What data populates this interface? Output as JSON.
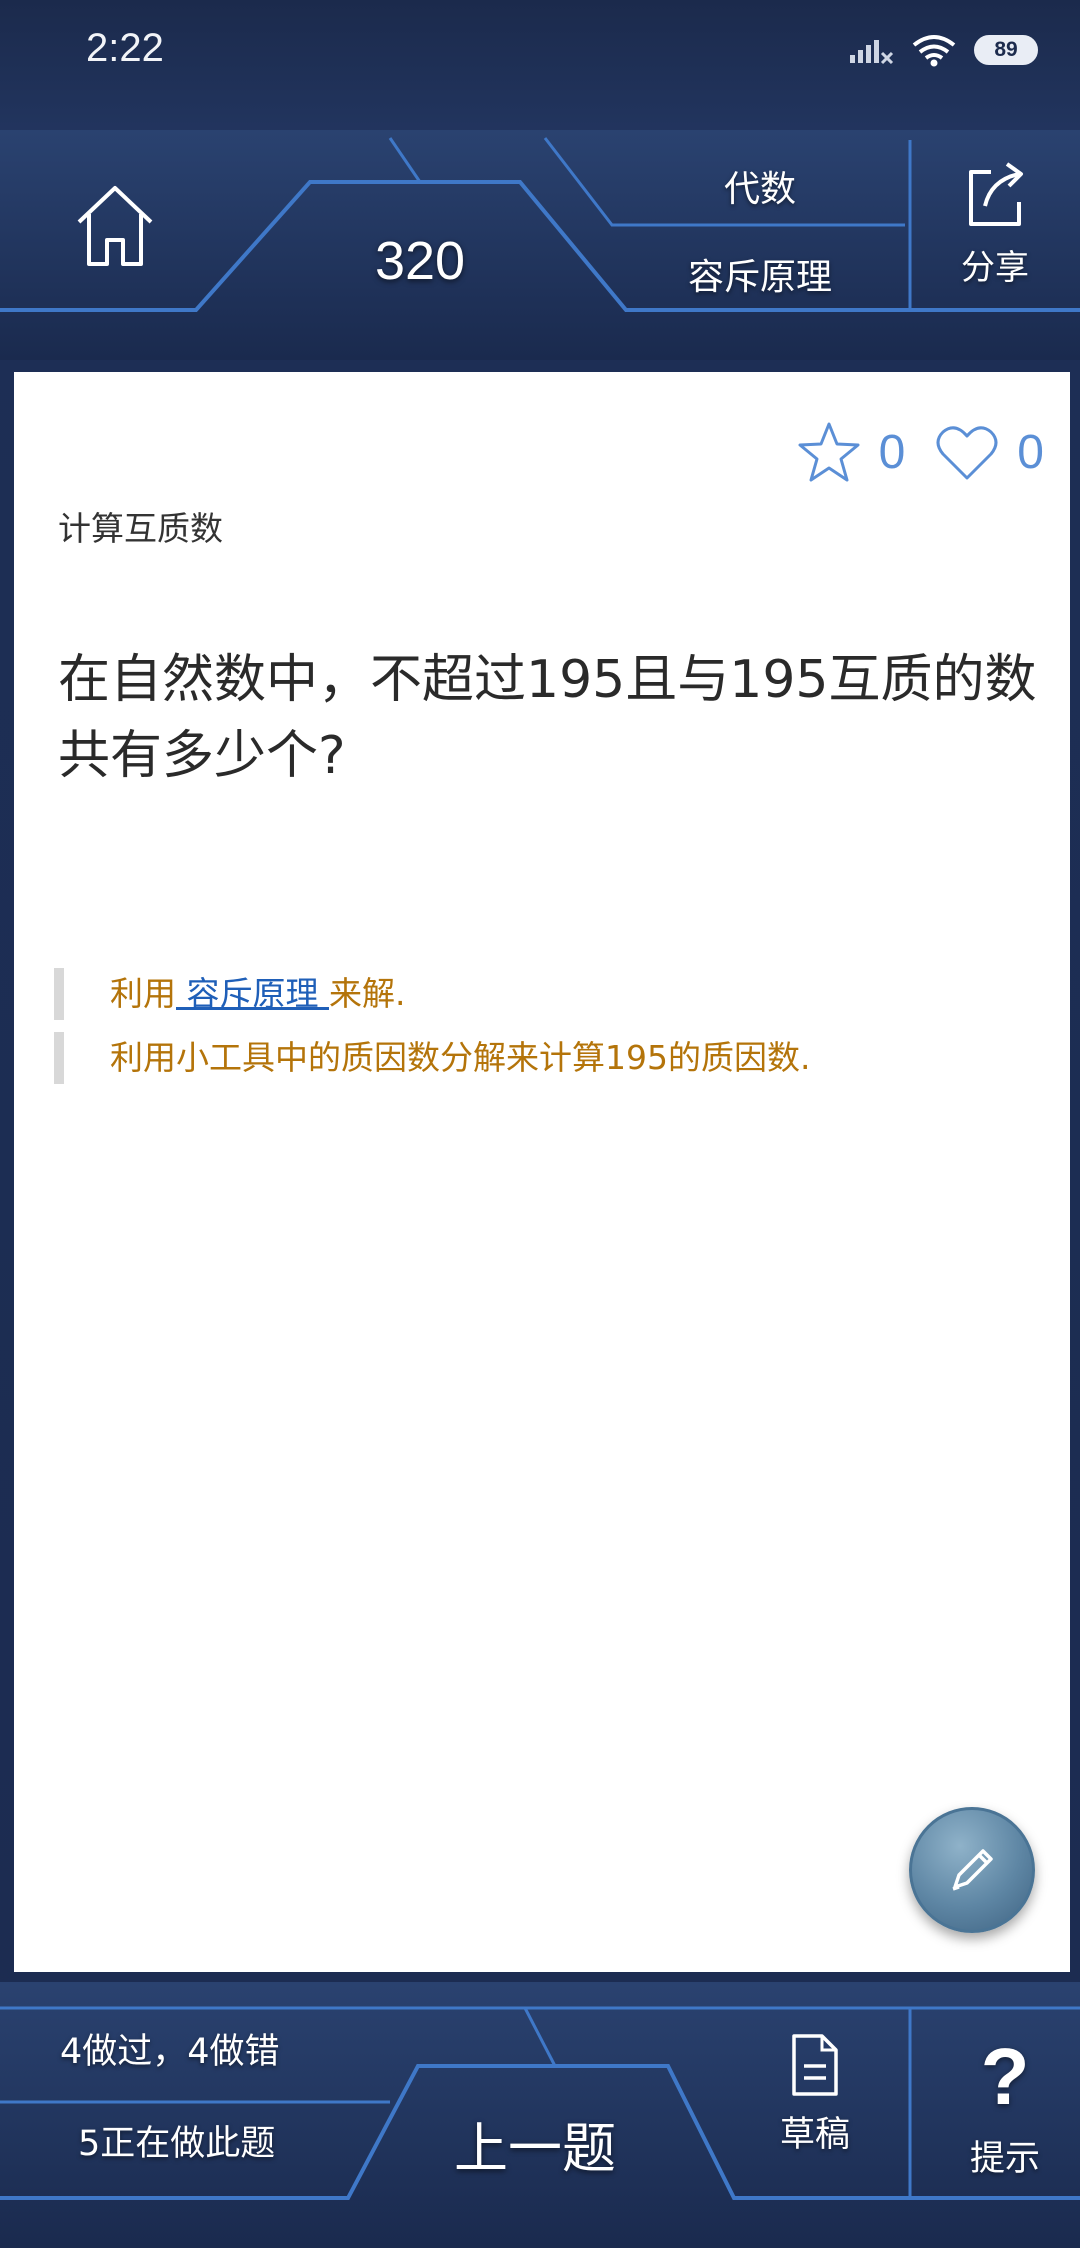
{
  "status_bar": {
    "time": "2:22",
    "battery": "89"
  },
  "header": {
    "home_icon": "home-icon",
    "problem_number": "320",
    "category": "代数",
    "topic": "容斥原理",
    "share_label": "分享",
    "share_icon": "share-icon"
  },
  "card": {
    "favorites_count": "0",
    "likes_count": "0",
    "subtitle": "计算互质数",
    "question": "在自然数中，不超过195且与195互质的数共有多少个?",
    "hints": [
      {
        "prefix": "利用",
        "link": " 容斥原理 ",
        "suffix": "来解."
      },
      {
        "text": "利用小工具中的质因数分解来计算195的质因数."
      }
    ],
    "edit_icon": "pencil-icon"
  },
  "bottom_bar": {
    "stat_done": "4做过，4做错",
    "stat_active": "5正在做此题",
    "prev_label": "上一题",
    "draft_label": "草稿",
    "hint_label": "提示",
    "hint_symbol": "?"
  },
  "colors": {
    "frame_dark": "#1c2b4d",
    "frame_glow": "#4d8ee0",
    "hint_text": "#b4740a",
    "link": "#1f5fb8",
    "counter": "#5b8fd6"
  }
}
